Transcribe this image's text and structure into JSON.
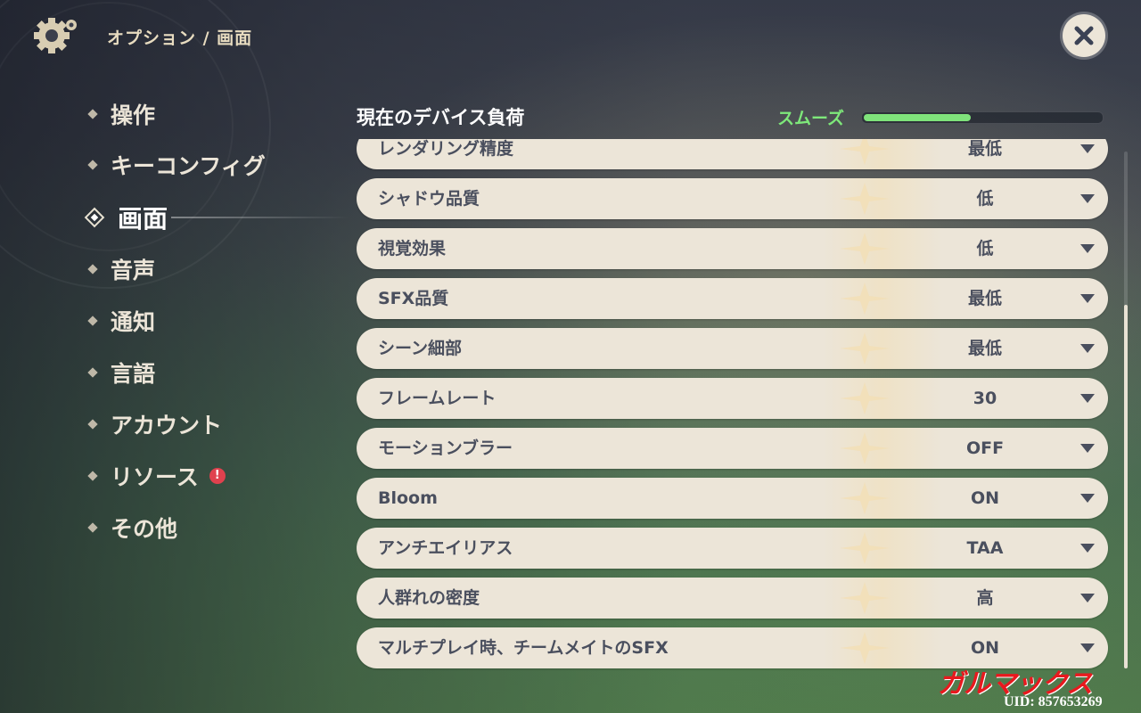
{
  "header": {
    "breadcrumb": "オプション / 画面",
    "icons": {
      "settings": "gear-icon",
      "close": "close-icon"
    }
  },
  "nav": {
    "items": [
      {
        "label": "操作",
        "active": false
      },
      {
        "label": "キーコンフィグ",
        "active": false
      },
      {
        "label": "画面",
        "active": true
      },
      {
        "label": "音声",
        "active": false
      },
      {
        "label": "通知",
        "active": false
      },
      {
        "label": "言語",
        "active": false
      },
      {
        "label": "アカウント",
        "active": false
      },
      {
        "label": "リソース",
        "active": false,
        "alert": "!"
      },
      {
        "label": "その他",
        "active": false
      }
    ]
  },
  "device_load": {
    "title": "現在のデバイス負荷",
    "status": "スムーズ",
    "level": 0.45,
    "color": "#7fe37b"
  },
  "settings": [
    {
      "label": "レンダリング精度",
      "value": "最低"
    },
    {
      "label": "シャドウ品質",
      "value": "低"
    },
    {
      "label": "視覚効果",
      "value": "低"
    },
    {
      "label": "SFX品質",
      "value": "最低"
    },
    {
      "label": "シーン細部",
      "value": "最低"
    },
    {
      "label": "フレームレート",
      "value": "30"
    },
    {
      "label": "モーションブラー",
      "value": "OFF"
    },
    {
      "label": "Bloom",
      "value": "ON"
    },
    {
      "label": "アンチエイリアス",
      "value": "TAA"
    },
    {
      "label": "人群れの密度",
      "value": "高"
    },
    {
      "label": "マルチプレイ時、チームメイトのSFX",
      "value": "ON"
    }
  ],
  "watermark": {
    "logo": "ガルマックス",
    "uid": "UID: 857653269"
  },
  "colors": {
    "row_bg": "#ece5d8",
    "row_text": "#4a4f5e",
    "alert": "#e0414e"
  }
}
